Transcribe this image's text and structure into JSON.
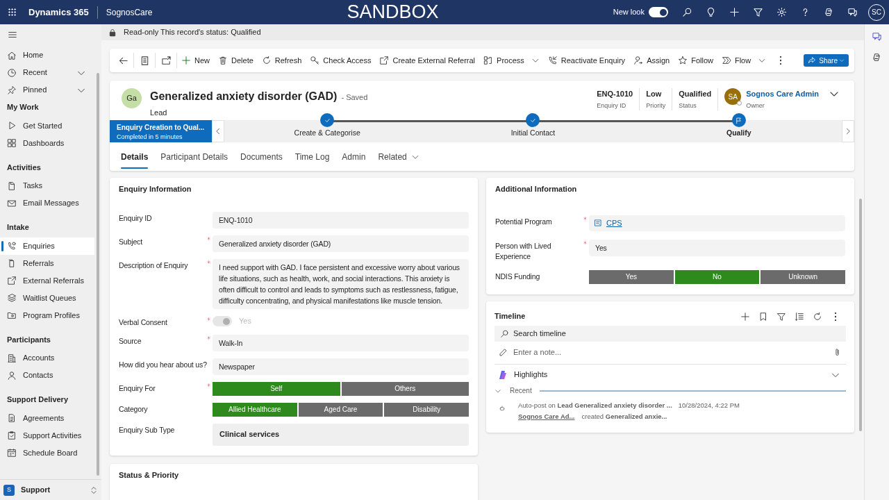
{
  "top_bar": {
    "app_name": "Dynamics 365",
    "environment": "SognosCare",
    "banner": "SANDBOX",
    "new_look": {
      "label": "New look",
      "on": true
    },
    "avatar": "SC"
  },
  "sidebar": {
    "sections": [
      {
        "items": [
          {
            "label": "Home",
            "selected": false,
            "expandable": false
          },
          {
            "label": "Recent",
            "selected": false,
            "expandable": true
          },
          {
            "label": "Pinned",
            "selected": false,
            "expandable": true
          }
        ]
      },
      {
        "heading": "My Work",
        "items": [
          {
            "label": "Get Started",
            "selected": false,
            "expandable": false
          },
          {
            "label": "Dashboards",
            "selected": false,
            "expandable": false
          }
        ]
      },
      {
        "heading": "Activities",
        "items": [
          {
            "label": "Tasks",
            "selected": false,
            "expandable": false
          },
          {
            "label": "Email Messages",
            "selected": false,
            "expandable": false
          }
        ]
      },
      {
        "heading": "Intake",
        "items": [
          {
            "label": "Enquiries",
            "selected": true,
            "expandable": false
          },
          {
            "label": "Referrals",
            "selected": false,
            "expandable": false
          },
          {
            "label": "External Referrals",
            "selected": false,
            "expandable": false
          },
          {
            "label": "Waitlist Queues",
            "selected": false,
            "expandable": false
          },
          {
            "label": "Program Profiles",
            "selected": false,
            "expandable": false
          }
        ]
      },
      {
        "heading": "Participants",
        "items": [
          {
            "label": "Accounts",
            "selected": false,
            "expandable": false
          },
          {
            "label": "Contacts",
            "selected": false,
            "expandable": false
          }
        ]
      },
      {
        "heading": "Support Delivery",
        "items": [
          {
            "label": "Agreements",
            "selected": false,
            "expandable": false
          },
          {
            "label": "Support Activities",
            "selected": false,
            "expandable": false
          },
          {
            "label": "Schedule Board",
            "selected": false,
            "expandable": false
          }
        ]
      }
    ],
    "area": {
      "badge": "S",
      "label": "Support"
    }
  },
  "readonly_banner": "Read-only This record's status: Qualified",
  "command_bar": {
    "commands": [
      {
        "label": "New",
        "dropdown": false
      },
      {
        "label": "Delete",
        "dropdown": false
      },
      {
        "label": "Refresh",
        "dropdown": false
      },
      {
        "label": "Check Access",
        "dropdown": false
      },
      {
        "label": "Create External Referral",
        "dropdown": false
      },
      {
        "label": "Process",
        "dropdown": true
      },
      {
        "label": "Reactivate Enquiry",
        "dropdown": false
      },
      {
        "label": "Assign",
        "dropdown": false
      },
      {
        "label": "Follow",
        "dropdown": false
      },
      {
        "label": "Flow",
        "dropdown": true
      }
    ],
    "share": "Share"
  },
  "header": {
    "avatar": "Ga",
    "title": "Generalized anxiety disorder (GAD)",
    "save_state": "- Saved",
    "entity": "Lead",
    "fields": [
      {
        "value": "ENQ-1010",
        "label": "Enquiry ID"
      },
      {
        "value": "Low",
        "label": "Priority"
      },
      {
        "value": "Qualified",
        "label": "Status"
      }
    ],
    "owner": {
      "avatar": "SA",
      "name": "Sognos Care Admin",
      "label": "Owner"
    }
  },
  "process": {
    "name": "Enquiry Creation to Qual...",
    "duration": "Completed in 5 minutes",
    "stages": [
      {
        "label": "Create & Categorise",
        "completed": true,
        "selected": false
      },
      {
        "label": "Initial Contact",
        "completed": true,
        "selected": false
      },
      {
        "label": "Qualify",
        "completed": false,
        "selected": true
      }
    ]
  },
  "tabs": [
    {
      "label": "Details",
      "selected": true,
      "dropdown": false
    },
    {
      "label": "Participant Details",
      "selected": false,
      "dropdown": false
    },
    {
      "label": "Documents",
      "selected": false,
      "dropdown": false
    },
    {
      "label": "Time Log",
      "selected": false,
      "dropdown": false
    },
    {
      "label": "Admin",
      "selected": false,
      "dropdown": false
    },
    {
      "label": "Related",
      "selected": false,
      "dropdown": true
    }
  ],
  "enquiry_information": {
    "title": "Enquiry Information",
    "fields": [
      {
        "kind": "text",
        "label": "Enquiry ID",
        "required": false,
        "value": "ENQ-1010"
      },
      {
        "kind": "text",
        "label": "Subject",
        "required": true,
        "value": "Generalized anxiety disorder (GAD)"
      },
      {
        "kind": "text",
        "label": "Description of Enquiry",
        "required": true,
        "value": "I need support with GAD. I face persistent and excessive worry about various life situations, such as health, work, and social interactions. This anxiety is often difficult to control and leads to symptoms such as restlessness, fatigue, difficulty concentrating, and physical manifestations like muscle tension."
      },
      {
        "kind": "toggle",
        "label": "Verbal Consent",
        "required": true,
        "on": true,
        "disabled": true,
        "value": "Yes"
      },
      {
        "kind": "text",
        "label": "Source",
        "required": true,
        "value": "Walk-In"
      },
      {
        "kind": "text",
        "label": "How did you hear about us?",
        "required": false,
        "value": "Newspaper"
      },
      {
        "kind": "options",
        "label": "Enquiry For",
        "required": true,
        "options": [
          {
            "label": "Self",
            "selected": true
          },
          {
            "label": "Others",
            "selected": false
          }
        ]
      },
      {
        "kind": "options",
        "label": "Category",
        "required": false,
        "options": [
          {
            "label": "Allied Healthcare",
            "selected": true
          },
          {
            "label": "Aged Care",
            "selected": false
          },
          {
            "label": "Disability",
            "selected": false
          }
        ]
      },
      {
        "kind": "choice",
        "label": "Enquiry Sub Type",
        "required": false,
        "value": "Clinical services"
      }
    ]
  },
  "status_priority": {
    "title": "Status & Priority"
  },
  "additional_information": {
    "title": "Additional Information",
    "fields": [
      {
        "kind": "lookup",
        "label": "Potential Program",
        "required": true,
        "value": "CPS"
      },
      {
        "kind": "text",
        "label": "Person with Lived Experience",
        "required": true,
        "value": "Yes"
      },
      {
        "kind": "options",
        "label": "NDIS Funding",
        "required": false,
        "options": [
          {
            "label": "Yes",
            "selected": false
          },
          {
            "label": "No",
            "selected": true
          },
          {
            "label": "Unknown",
            "selected": false
          }
        ]
      }
    ]
  },
  "timeline": {
    "title": "Timeline",
    "search_placeholder": "Search timeline",
    "note_placeholder": "Enter a note...",
    "highlights": "Highlights",
    "recent": "Recent",
    "posts": [
      {
        "headline": "Auto-post on **Lead Generalized anxiety disorder ...**",
        "time": "10/28/2024, 4:22 PM",
        "author": "Sognos Care Ad...",
        "action": "created **Generalized anxie...**"
      }
    ]
  }
}
